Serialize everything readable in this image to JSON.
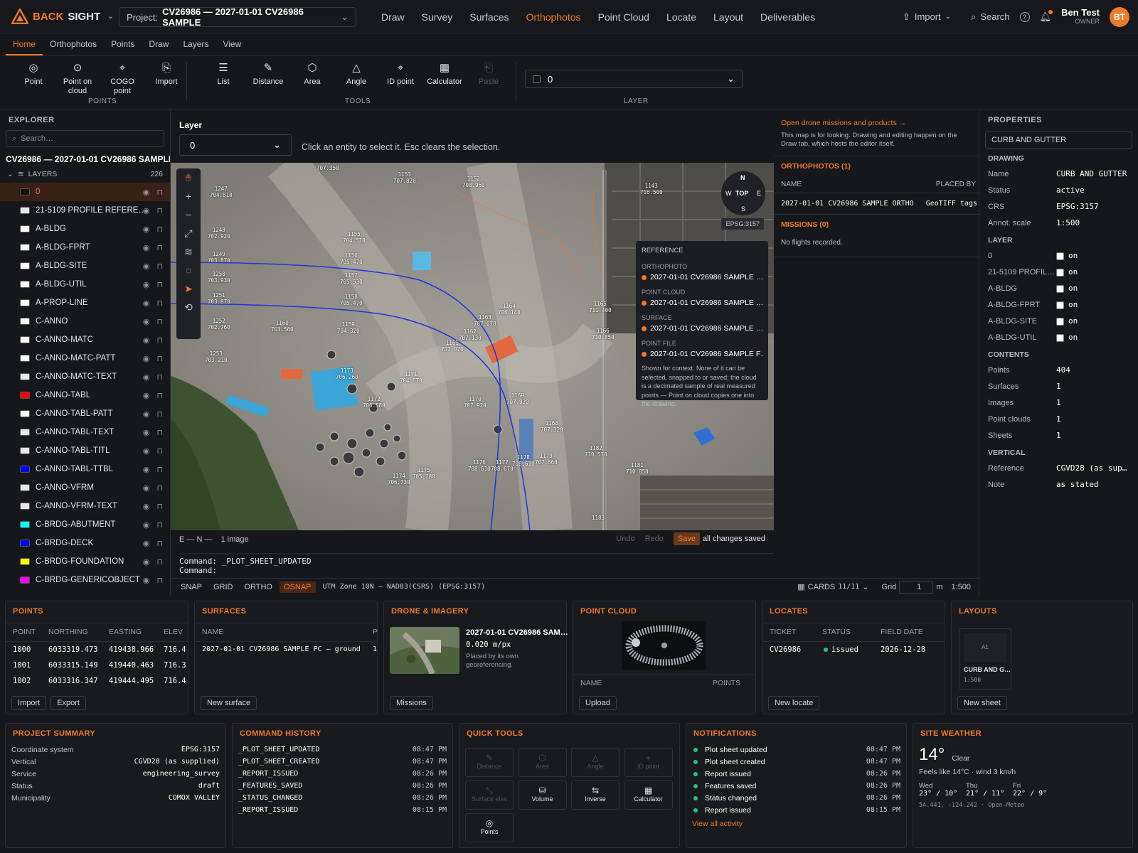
{
  "app": {
    "brand1": "BACK",
    "brand2": "SIGHT",
    "project_label": "Project:",
    "project_value": "CV26986 — 2027-01-01 CV26986 SAMPLE"
  },
  "nav": [
    "Draw",
    "Survey",
    "Surfaces",
    "Orthophotos",
    "Point Cloud",
    "Locate",
    "Layout",
    "Deliverables"
  ],
  "nav_active": "Orthophotos",
  "topright": {
    "import": "Import",
    "search": "Search",
    "user_name": "Ben Test",
    "user_role": "OWNER",
    "initials": "BT"
  },
  "subtabs": [
    "Home",
    "Orthophotos",
    "Points",
    "Draw",
    "Layers",
    "View"
  ],
  "ribbon": {
    "points": [
      {
        "label": "Point",
        "icon": "target-icon"
      },
      {
        "label": "Point on cloud",
        "icon": "point-cloud-icon"
      },
      {
        "label": "COGO point",
        "icon": "cogo-icon"
      },
      {
        "label": "Import",
        "icon": "import-icon"
      }
    ],
    "tools": [
      {
        "label": "List",
        "icon": "list-icon"
      },
      {
        "label": "Distance",
        "icon": "ruler-icon"
      },
      {
        "label": "Area",
        "icon": "hexagon-icon"
      },
      {
        "label": "Angle",
        "icon": "triangle-icon"
      },
      {
        "label": "ID point",
        "icon": "crosshair-icon"
      },
      {
        "label": "Calculator",
        "icon": "calculator-icon"
      },
      {
        "label": "Paste",
        "icon": "paste-icon"
      }
    ],
    "group_points": "POINTS",
    "group_tools": "TOOLS",
    "group_layer": "LAYER",
    "layer_value": "0"
  },
  "explorer": {
    "title": "EXPLORER",
    "search_placeholder": "Search…",
    "project": "CV26986 — 2027-01-01 CV26986 SAMPLE",
    "layers_label": "LAYERS",
    "layers_count": "226",
    "layers": [
      {
        "name": "0",
        "color": "#111111"
      },
      {
        "name": "21-5109 PROFILE REFERE…",
        "color": "#e8e8e8"
      },
      {
        "name": "A-BLDG",
        "color": "#ffffff"
      },
      {
        "name": "A-BLDG-FPRT",
        "color": "#ffffff"
      },
      {
        "name": "A-BLDG-SITE",
        "color": "#ffffff"
      },
      {
        "name": "A-BLDG-UTIL",
        "color": "#ffffff"
      },
      {
        "name": "A-PROP-LINE",
        "color": "#ffffff"
      },
      {
        "name": "C-ANNO",
        "color": "#ffffff"
      },
      {
        "name": "C-ANNO-MATC",
        "color": "#ffffff"
      },
      {
        "name": "C-ANNO-MATC-PATT",
        "color": "#ffffff"
      },
      {
        "name": "C-ANNO-MATC-TEXT",
        "color": "#e8e8e8"
      },
      {
        "name": "C-ANNO-TABL",
        "color": "#ff0000"
      },
      {
        "name": "C-ANNO-TABL-PATT",
        "color": "#ffffff"
      },
      {
        "name": "C-ANNO-TABL-TEXT",
        "color": "#e8e8e8"
      },
      {
        "name": "C-ANNO-TABL-TITL",
        "color": "#e8e8e8"
      },
      {
        "name": "C-ANNO-TABL-TTBL",
        "color": "#0000ff"
      },
      {
        "name": "C-ANNO-VFRM",
        "color": "#e8e8e8"
      },
      {
        "name": "C-ANNO-VFRM-TEXT",
        "color": "#e8e8e8"
      },
      {
        "name": "C-BRDG-ABUTMENT",
        "color": "#00ffff"
      },
      {
        "name": "C-BRDG-DECK",
        "color": "#0000ff"
      },
      {
        "name": "C-BRDG-FOUNDATION",
        "color": "#ffff00"
      },
      {
        "name": "C-BRDG-GENERICOBJECT",
        "color": "#ff00ff"
      }
    ]
  },
  "center": {
    "layer_label": "Layer",
    "layer_value": "0",
    "hint": "Click an entity to select it. Esc clears the selection.",
    "epsg": "EPSG:3157",
    "compass": {
      "n": "N",
      "s": "S",
      "e": "E",
      "w": "W",
      "top": "TOP"
    },
    "reference": {
      "title": "REFERENCE",
      "ortho_h": "ORTHOPHOTO",
      "ortho": "2027-01-01 CV26986 SAMPLE …",
      "pc_h": "POINT CLOUD",
      "pc": "2027-01-01 CV26986 SAMPLE …",
      "surf_h": "SURFACE",
      "surf": "2027-01-01 CV26986 SAMPLE …",
      "pf_h": "POINT FILE",
      "pf": "2027-01-01 CV26986 SAMPLE F…",
      "note": "Shown for context. None of it can be selected, snapped to or saved; the cloud is a decimated sample of real measured points — Point on cloud copies one into the drawing."
    },
    "map_points": [
      {
        "id": "1154",
        "z": "707.350"
      },
      {
        "id": "1247",
        "z": "704.810"
      },
      {
        "id": "1153",
        "z": "707.820"
      },
      {
        "id": "1152",
        "z": "708.960"
      },
      {
        "id": "1143",
        "z": "716.500"
      },
      {
        "id": "1248",
        "z": "702.920"
      },
      {
        "id": "1155",
        "z": "704.520"
      },
      {
        "id": "1249",
        "z": "703.870"
      },
      {
        "id": "1156",
        "z": "705.470"
      },
      {
        "id": "1250",
        "z": "703.930"
      },
      {
        "id": "1157",
        "z": "705.530"
      },
      {
        "id": "1251",
        "z": "703.870"
      },
      {
        "id": "1158",
        "z": "705.470"
      },
      {
        "id": "1164",
        "z": "706.140"
      },
      {
        "id": "1165",
        "z": "711.400"
      },
      {
        "id": "1252",
        "z": "702.760"
      },
      {
        "id": "1160",
        "z": "703.560"
      },
      {
        "id": "1159",
        "z": "704.320"
      },
      {
        "id": "1163",
        "z": "707.070"
      },
      {
        "id": "1162",
        "z": "707.130"
      },
      {
        "id": "1166",
        "z": "710.850"
      },
      {
        "id": "1253",
        "z": "703.210"
      },
      {
        "id": "1161",
        "z": "707.070"
      },
      {
        "id": "1173",
        "z": "706.260"
      },
      {
        "id": "1171",
        "z": "704.670"
      },
      {
        "id": "1172",
        "z": "706.580"
      },
      {
        "id": "1170",
        "z": "707.920"
      },
      {
        "id": "1169",
        "z": "707.920"
      },
      {
        "id": "1168",
        "z": "707.320"
      },
      {
        "id": "1182",
        "z": "710.570"
      },
      {
        "id": "1176",
        "z": "708.610"
      },
      {
        "id": "1177",
        "z": "708.670"
      },
      {
        "id": "1178",
        "z": "708.610"
      },
      {
        "id": "1179",
        "z": "707.660"
      },
      {
        "id": "1181",
        "z": "710.850"
      },
      {
        "id": "1175",
        "z": "705.780"
      },
      {
        "id": "1174",
        "z": "706.730"
      },
      {
        "id": "1183",
        "z": ""
      }
    ],
    "status": {
      "coords": "E — N —",
      "images": "1 image",
      "undo": "Undo",
      "redo": "Redo",
      "save": "Save",
      "saved": "all changes saved"
    },
    "cmd1_label": "Command:",
    "cmd1": "_PLOT_SHEET_UPDATED",
    "cmd2_label": "Command:",
    "bar": {
      "snap": "SNAP",
      "grid": "GRID",
      "ortho": "ORTHO",
      "osnap": "OSNAP",
      "crs": "UTM Zone 10N — NAD83(CSRS) (EPSG:3157)",
      "cards": "CARDS",
      "cards_count": "11/11",
      "grid_label": "Grid",
      "grid_value": "1",
      "unit": "m",
      "scale": "1:500"
    }
  },
  "drone": {
    "link": "Open drone missions and products →",
    "desc": "This map is for looking. Drawing and editing happen on the Draw tab, which hosts the editor itself.",
    "ortho_title": "ORTHOPHOTOS (1)",
    "col_name": "NAME",
    "col_placed": "PLACED BY",
    "row_name": "2027-01-01 CV26986 SAMPLE ORTHO",
    "row_placed": "GeoTIFF tags",
    "missions_title": "MISSIONS (0)",
    "no_flights": "No flights recorded."
  },
  "properties": {
    "title": "PROPERTIES",
    "selected": "CURB AND GUTTER",
    "drawing_h": "DRAWING",
    "drawing": [
      {
        "k": "Name",
        "v": "CURB AND GUTTER"
      },
      {
        "k": "Status",
        "v": "active"
      },
      {
        "k": "CRS",
        "v": "EPSG:3157"
      },
      {
        "k": "Annot. scale",
        "v": "1:500"
      }
    ],
    "layer_h": "LAYER",
    "layer": [
      {
        "k": "0",
        "v": "on"
      },
      {
        "k": "21-5109 PROFIL…",
        "v": "on"
      },
      {
        "k": "A-BLDG",
        "v": "on"
      },
      {
        "k": "A-BLDG-FPRT",
        "v": "on"
      },
      {
        "k": "A-BLDG-SITE",
        "v": "on"
      },
      {
        "k": "A-BLDG-UTIL",
        "v": "on"
      }
    ],
    "contents_h": "CONTENTS",
    "contents": [
      {
        "k": "Points",
        "v": "404"
      },
      {
        "k": "Surfaces",
        "v": "1"
      },
      {
        "k": "Images",
        "v": "1"
      },
      {
        "k": "Point clouds",
        "v": "1"
      },
      {
        "k": "Sheets",
        "v": "1"
      }
    ],
    "vertical_h": "VERTICAL",
    "vertical": [
      {
        "k": "Reference",
        "v": "CGVD28 (as sup…"
      },
      {
        "k": "Note",
        "v": "as stated"
      }
    ]
  },
  "cards": {
    "points": {
      "title": "POINTS",
      "cols": [
        "POINT",
        "NORTHING",
        "EASTING",
        "ELEV"
      ],
      "rows": [
        [
          "1000",
          "6033319.473",
          "419438.966",
          "716.4"
        ],
        [
          "1001",
          "6033315.149",
          "419440.463",
          "716.3"
        ],
        [
          "1002",
          "6033316.347",
          "419444.495",
          "716.4"
        ]
      ],
      "b1": "Import",
      "b2": "Export"
    },
    "surfaces": {
      "title": "SURFACES",
      "col": "NAME",
      "col2": "P",
      "row": "2027-01-01 CV26986 SAMPLE PC — ground",
      "row2": "1",
      "b": "New surface"
    },
    "drone": {
      "title": "DRONE & IMAGERY",
      "name": "2027-01-01 CV26986 SAM…",
      "res": "0.020 m/px",
      "note": "Placed by its own georeferencing.",
      "b": "Missions"
    },
    "cloud": {
      "title": "POINT CLOUD",
      "col": "NAME",
      "col2": "POINTS",
      "b": "Upload"
    },
    "locates": {
      "title": "LOCATES",
      "cols": [
        "TICKET",
        "STATUS",
        "FIELD DATE"
      ],
      "ticket": "CV26986",
      "status": "issued",
      "date": "2026-12-28",
      "b": "New locate"
    },
    "layouts": {
      "title": "LAYOUTS",
      "sheet": "A1",
      "name": "CURB AND G…",
      "scale": "1:500",
      "b": "New sheet"
    }
  },
  "summary": {
    "title": "PROJECT SUMMARY",
    "rows": [
      {
        "k": "Coordinate system",
        "v": "EPSG:3157"
      },
      {
        "k": "Vertical",
        "v": "CGVD28 (as supplied)"
      },
      {
        "k": "Service",
        "v": "engineering_survey"
      },
      {
        "k": "Status",
        "v": "draft"
      },
      {
        "k": "Municipality",
        "v": "COMOX VALLEY"
      }
    ]
  },
  "history": {
    "title": "COMMAND HISTORY",
    "rows": [
      {
        "c": "_PLOT_SHEET_UPDATED",
        "t": "08:47 PM"
      },
      {
        "c": "_PLOT_SHEET_CREATED",
        "t": "08:47 PM"
      },
      {
        "c": "_REPORT_ISSUED",
        "t": "08:26 PM"
      },
      {
        "c": "_FEATURES_SAVED",
        "t": "08:26 PM"
      },
      {
        "c": "_STATUS_CHANGED",
        "t": "08:26 PM"
      },
      {
        "c": "_REPORT_ISSUED",
        "t": "08:15 PM"
      }
    ]
  },
  "quick": {
    "title": "QUICK TOOLS",
    "items": [
      {
        "l": "Distance",
        "dis": true,
        "i": "✎"
      },
      {
        "l": "Area",
        "dis": true,
        "i": "⬡"
      },
      {
        "l": "Angle",
        "dis": true,
        "i": "△"
      },
      {
        "l": "ID point",
        "dis": true,
        "i": "⌖"
      },
      {
        "l": "Surface elev",
        "dis": true,
        "i": "⤡"
      },
      {
        "l": "Volume",
        "dis": false,
        "i": "⛁"
      },
      {
        "l": "Inverse",
        "dis": false,
        "i": "⇆"
      },
      {
        "l": "Calculator",
        "dis": false,
        "i": "▦"
      },
      {
        "l": "Points",
        "dis": false,
        "i": "◎"
      }
    ]
  },
  "notifications": {
    "title": "NOTIFICATIONS",
    "rows": [
      {
        "m": "Plot sheet updated",
        "t": "08:47 PM"
      },
      {
        "m": "Plot sheet created",
        "t": "08:47 PM"
      },
      {
        "m": "Report issued",
        "t": "08:26 PM"
      },
      {
        "m": "Features saved",
        "t": "08:26 PM"
      },
      {
        "m": "Status changed",
        "t": "08:26 PM"
      },
      {
        "m": "Report issued",
        "t": "08:15 PM"
      }
    ],
    "link": "View all activity"
  },
  "weather": {
    "title": "SITE WEATHER",
    "temp": "14°",
    "cond": "Clear",
    "feels": "Feels like 14°C · wind 3 km/h",
    "days": [
      {
        "d": "Wed",
        "t": "23° / 10°"
      },
      {
        "d": "Thu",
        "t": "21° / 11°"
      },
      {
        "d": "Fri",
        "t": "22° / 9°"
      }
    ],
    "src": "54.441, -124.242 · Open-Meteo"
  }
}
